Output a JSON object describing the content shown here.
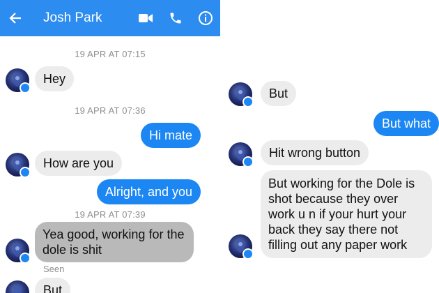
{
  "left": {
    "header": {
      "back_icon": "arrow-left-icon",
      "title": "Josh Park",
      "icons": [
        "video-camera-icon",
        "phone-icon",
        "info-icon"
      ],
      "color": "#2d8cf0"
    },
    "timestamps": [
      "19 APR AT 07:15",
      "19 APR AT 07:36",
      "19 APR AT 07:39"
    ],
    "messages": [
      {
        "side": "in",
        "text": "Hey"
      },
      {
        "side": "out",
        "text": "Hi mate"
      },
      {
        "side": "in",
        "text": "How are you"
      },
      {
        "side": "out",
        "text": "Alright, and you"
      },
      {
        "side": "in",
        "text": "Yea good, working for the dole is shit"
      },
      {
        "side": "in",
        "text": "But"
      }
    ],
    "seen_label": "Seen"
  },
  "right": {
    "messages": [
      {
        "side": "in",
        "text": "But"
      },
      {
        "side": "out",
        "text": "But what"
      },
      {
        "side": "in",
        "text": "Hit wrong button"
      },
      {
        "side": "in",
        "text": "But working for the Dole is shot because they over work u n if your  hurt your back they say there not filling out any paper work"
      }
    ]
  },
  "colors": {
    "outgoing_bubble": "#1c86f2",
    "incoming_bubble": "#ececec",
    "selected_bubble": "#b9b9b9",
    "timestamp_text": "#8e8e93"
  }
}
